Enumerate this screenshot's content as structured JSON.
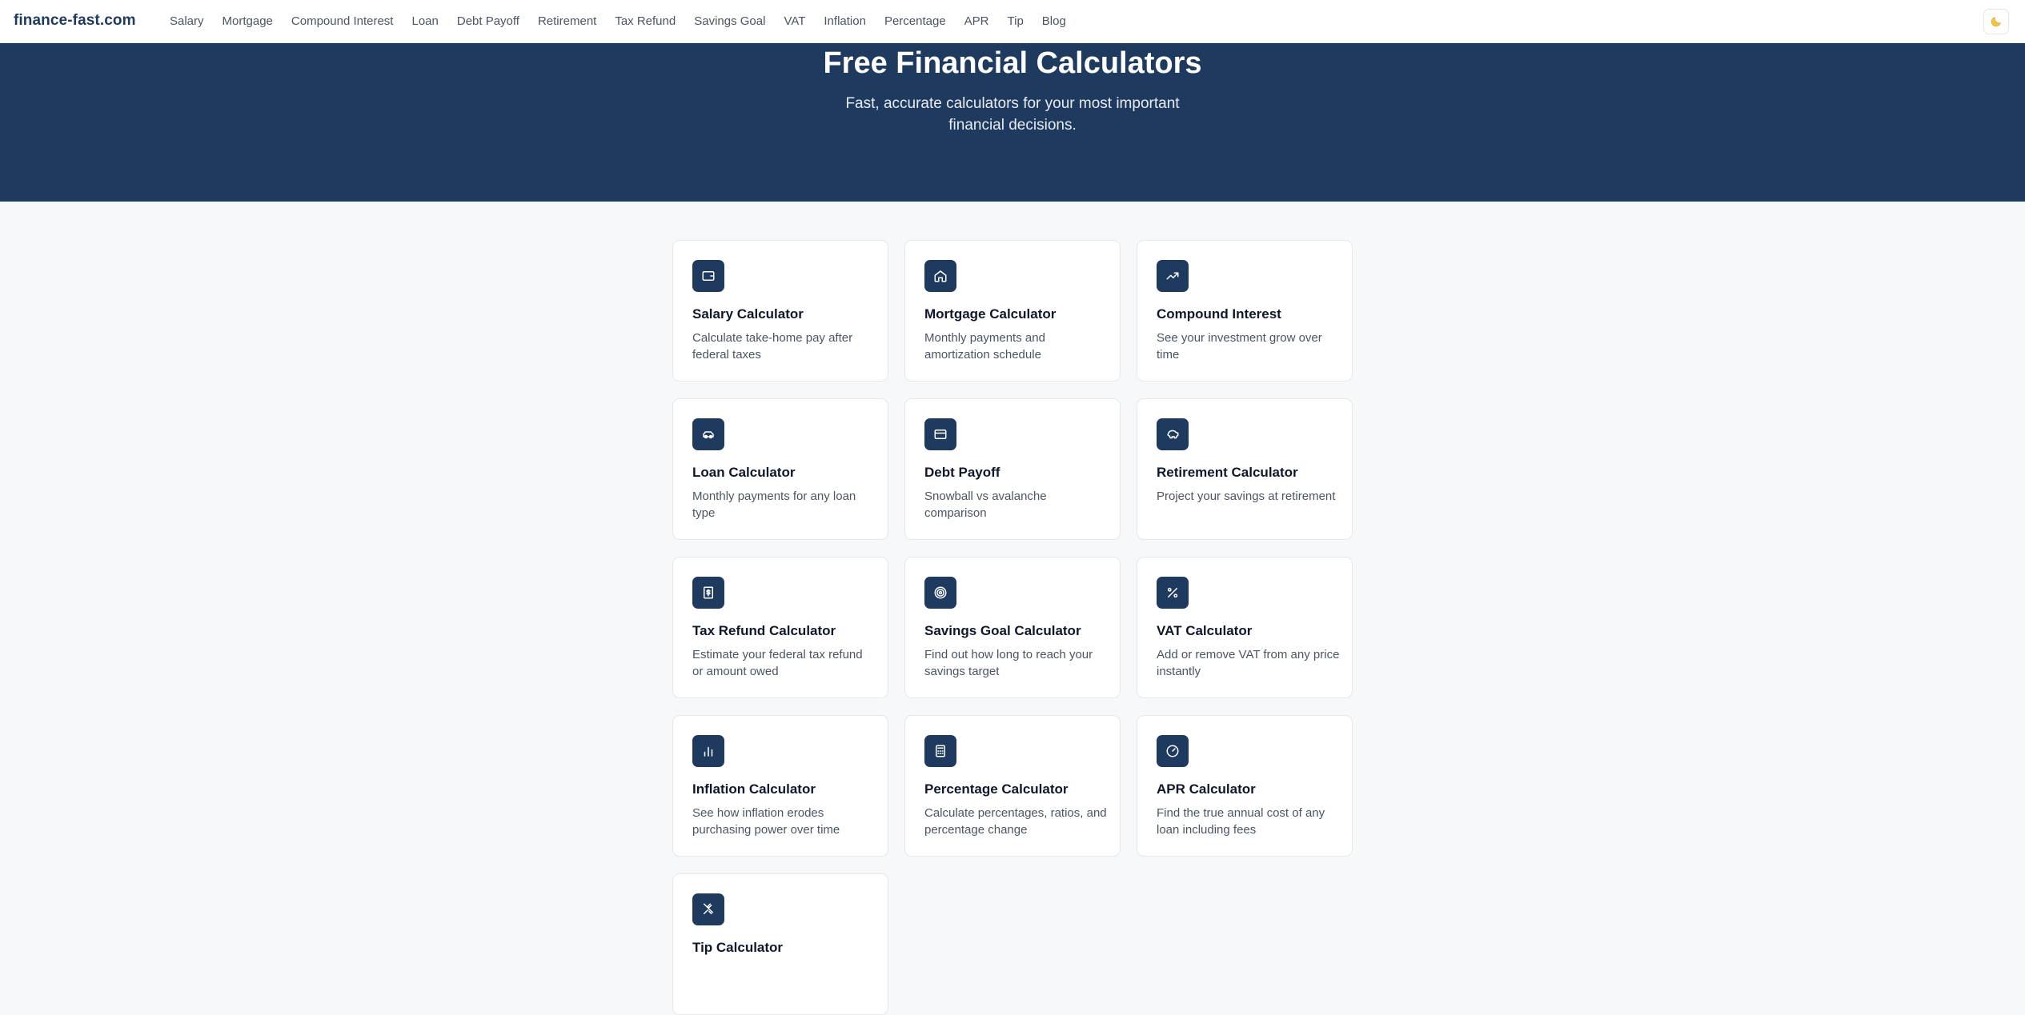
{
  "header": {
    "brand": "finance-fast.com",
    "nav": [
      "Salary",
      "Mortgage",
      "Compound Interest",
      "Loan",
      "Debt Payoff",
      "Retirement",
      "Tax Refund",
      "Savings Goal",
      "VAT",
      "Inflation",
      "Percentage",
      "APR",
      "Tip",
      "Blog"
    ],
    "theme_toggle_icon": "moon-icon"
  },
  "hero": {
    "title": "Free Financial Calculators",
    "subtitle": "Fast, accurate calculators for your most important financial decisions."
  },
  "cards": [
    {
      "title": "Salary Calculator",
      "desc": "Calculate take-home pay after federal taxes",
      "icon": "wallet-icon"
    },
    {
      "title": "Mortgage Calculator",
      "desc": "Monthly payments and amortization schedule",
      "icon": "home-icon"
    },
    {
      "title": "Compound Interest",
      "desc": "See your investment grow over time",
      "icon": "trending-up-icon"
    },
    {
      "title": "Loan Calculator",
      "desc": "Monthly payments for any loan type",
      "icon": "car-icon"
    },
    {
      "title": "Debt Payoff",
      "desc": "Snowball vs avalanche comparison",
      "icon": "credit-card-icon"
    },
    {
      "title": "Retirement Calculator",
      "desc": "Project your savings at retirement",
      "icon": "piggy-bank-icon"
    },
    {
      "title": "Tax Refund Calculator",
      "desc": "Estimate your federal tax refund or amount owed",
      "icon": "receipt-icon"
    },
    {
      "title": "Savings Goal Calculator",
      "desc": "Find out how long to reach your savings target",
      "icon": "target-icon"
    },
    {
      "title": "VAT Calculator",
      "desc": "Add or remove VAT from any price instantly",
      "icon": "percent-icon"
    },
    {
      "title": "Inflation Calculator",
      "desc": "See how inflation erodes purchasing power over time",
      "icon": "bar-chart-icon"
    },
    {
      "title": "Percentage Calculator",
      "desc": "Calculate percentages, ratios, and percentage change",
      "icon": "calculator-icon"
    },
    {
      "title": "APR Calculator",
      "desc": "Find the true annual cost of any loan including fees",
      "icon": "gauge-icon"
    },
    {
      "title": "Tip Calculator",
      "desc": "",
      "icon": "utensils-icon"
    }
  ],
  "colors": {
    "brand": "#1e3a5f",
    "background": "#f7f8fa",
    "card_border": "#e5e7eb"
  }
}
